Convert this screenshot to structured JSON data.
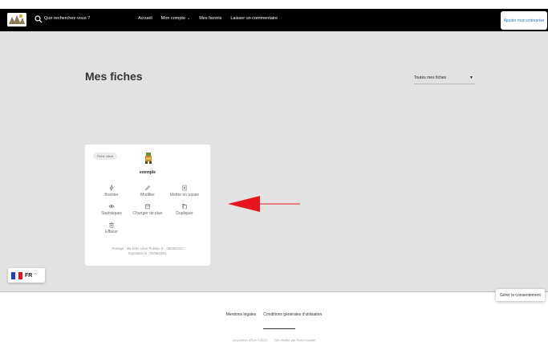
{
  "header": {
    "search_placeholder": "Que recherchez-vous ?",
    "nav": [
      "Accueil",
      "Mon compte",
      "Mes favoris",
      "Laisser un commentaire"
    ],
    "cta_label": "Ajouter mon entreprise"
  },
  "main": {
    "title": "Mes fiches",
    "filter_value": "Toutes mes fiches"
  },
  "card": {
    "chip": "Fiche client",
    "name": "exemple",
    "actions": [
      {
        "label": "Booster",
        "icon": "bolt-icon"
      },
      {
        "label": "Modifier",
        "icon": "pencil-icon"
      },
      {
        "label": "Mettre en pause",
        "icon": "pause-icon"
      },
      {
        "label": "Statistiques",
        "icon": "eye-icon"
      },
      {
        "label": "Changer de plan",
        "icon": "calendar-icon"
      },
      {
        "label": "Dupliquer",
        "icon": "copy-icon"
      },
      {
        "label": "Effacer",
        "icon": "trash-icon"
      }
    ],
    "share_line1": "Partage : Ma fiche client   Publiée le : 09/09/2023",
    "share_line2": "Expiration le : 03/06/2091"
  },
  "language": {
    "code": "FR"
  },
  "footer": {
    "consent": "Gérer le consentement",
    "links": [
      "Mentions légales",
      "Conditions générales d'utilisation"
    ],
    "legal": [
      "La pomme d'Ève ©2023",
      "Site réalisé par Rose Sociale"
    ]
  },
  "colors": {
    "accent": "#2a73c7",
    "arrow": "#e8141e",
    "topbar": "#000000",
    "background": "#e3e2e2"
  }
}
